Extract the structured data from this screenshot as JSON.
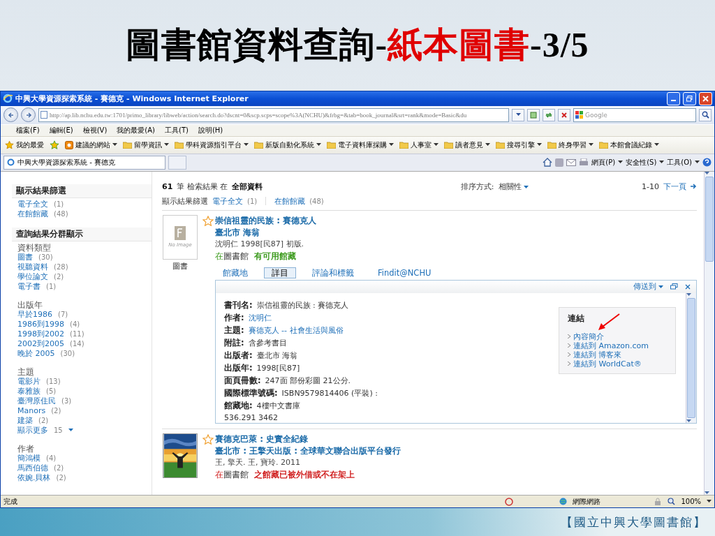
{
  "slide": {
    "title_parts": [
      {
        "text": "圖書館資料查詢-",
        "kind": "plain"
      },
      {
        "text": "紙本圖書",
        "kind": "accent"
      },
      {
        "text": "-3/5",
        "kind": "plain"
      }
    ],
    "footer": "【國立中興大學圖書館】"
  },
  "window": {
    "title": "中興大學資源探索系統 - 賽德克 - Windows Internet Explorer"
  },
  "address": {
    "url": "http://ap.lib.nchu.edu.tw:1701/primo_library/libweb/action/search.do?dscnt=0&scp.scps=scope%3A(NCHU)&frbg=&tab=book_journal&srt=rank&mode=Basic&du",
    "search_placeholder": "Google"
  },
  "menu": [
    "檔案(F)",
    "編輯(E)",
    "檢視(V)",
    "我的最愛(A)",
    "工具(T)",
    "說明(H)"
  ],
  "favorites": {
    "label": "我的最愛",
    "items": [
      {
        "label": "建議的網站",
        "kind": "site"
      },
      {
        "label": "留學資訊",
        "kind": "folder"
      },
      {
        "label": "學科資源指引平台",
        "kind": "folder"
      },
      {
        "label": "新版自動化系統",
        "kind": "folder"
      },
      {
        "label": "電子資料庫採購",
        "kind": "folder"
      },
      {
        "label": "人事室",
        "kind": "folder"
      },
      {
        "label": "讀者意見",
        "kind": "folder"
      },
      {
        "label": "搜尋引擎",
        "kind": "folder"
      },
      {
        "label": "終身學習",
        "kind": "folder"
      },
      {
        "label": "本館會議紀錄",
        "kind": "folder"
      }
    ]
  },
  "tab": {
    "label": "中興大學資源探索系統 - 賽德克"
  },
  "command_bar": [
    "網頁(P)",
    "安全性(S)",
    "工具(O)"
  ],
  "sidebar": {
    "sections": [
      {
        "title": "顯示結果篩選",
        "groups": [
          {
            "items": [
              {
                "label": "電子全文",
                "count": "(1)"
              },
              {
                "label": "在館館藏",
                "count": "(48)"
              }
            ]
          }
        ]
      },
      {
        "title": "查詢結果分群顯示",
        "groups": [
          {
            "heading": "資料類型",
            "items": [
              {
                "label": "圖書",
                "count": "(30)"
              },
              {
                "label": "視聽資料",
                "count": "(28)"
              },
              {
                "label": "學位論文",
                "count": "(2)"
              },
              {
                "label": "電子書",
                "count": "(1)"
              }
            ]
          },
          {
            "heading": "出版年",
            "items": [
              {
                "label": "早於1986",
                "count": "(7)"
              },
              {
                "label": "1986到1998",
                "count": "(4)"
              },
              {
                "label": "1998到2002",
                "count": "(11)"
              },
              {
                "label": "2002到2005",
                "count": "(14)"
              },
              {
                "label": "晚於 2005",
                "count": "(30)"
              }
            ]
          },
          {
            "heading": "主題",
            "items": [
              {
                "label": "電影片",
                "count": "(13)"
              },
              {
                "label": "泰雅族",
                "count": "(5)"
              },
              {
                "label": "臺灣原住民",
                "count": "(3)"
              },
              {
                "label": "Manors",
                "count": "(2)"
              },
              {
                "label": "建築",
                "count": "(2)"
              }
            ],
            "more": {
              "label": "顯示更多",
              "count": "15"
            }
          },
          {
            "heading": "作者",
            "items": [
              {
                "label": "簡鴻模",
                "count": "(4)"
              },
              {
                "label": "馬西伯德",
                "count": "(2)"
              },
              {
                "label": "依婉.貝林",
                "count": "(2)"
              }
            ]
          }
        ]
      }
    ]
  },
  "results_header": {
    "count": "61",
    "text": "筆 檢索結果 在",
    "scope": "全部資料",
    "sort_label": "排序方式:",
    "sort_value": "相關性",
    "range": "1-10",
    "next": "下一頁",
    "filter_label": "顯示結果篩選",
    "filters": [
      {
        "label": "電子全文",
        "count": "(1)"
      },
      {
        "label": "在館館藏",
        "count": "(48)"
      }
    ]
  },
  "results": [
    {
      "cover": {
        "kind": "placeholder",
        "text": "No Image"
      },
      "type": "圖書",
      "title": "崇信祖靈的民族 : 賽德克人",
      "publisher": "臺北市 海翁",
      "meta": "沈明仁 1998[民87] 初版.",
      "location": "在圖書館",
      "availability": "有可用館藏",
      "available": true,
      "tabs": [
        {
          "label": "館藏地",
          "selected": false
        },
        {
          "label": "詳目",
          "selected": true
        },
        {
          "label": "評論和標籤",
          "selected": false
        },
        {
          "label": "Findit@NCHU",
          "selected": false
        }
      ],
      "details": {
        "send_to": "傳送到",
        "fields": [
          {
            "label": "書刊名:",
            "value": "崇信祖靈的民族 : 賽德克人",
            "link": false
          },
          {
            "label": "作者:",
            "value": "沈明仁",
            "link": true
          },
          {
            "label": "主題:",
            "value": "賽德克人 -- 社會生活與風俗",
            "link": true
          },
          {
            "label": "附註:",
            "value": "含參考書目",
            "link": false
          },
          {
            "label": "出版者:",
            "value": "臺北市 海翁",
            "link": false
          },
          {
            "label": "出版年:",
            "value": "1998[民87]",
            "link": false
          },
          {
            "label": "面頁冊數:",
            "value": "247面 部份彩圖 21公分.",
            "link": false
          },
          {
            "label": "國際標準號碼:",
            "value": "ISBN9579814406 (平裝) :",
            "link": false
          },
          {
            "label": "館藏地:",
            "value": "4樓中文書庫",
            "link": false
          },
          {
            "value": "536.291 3462",
            "link": false
          }
        ],
        "links_title": "連結",
        "links": [
          "內容簡介",
          "連結到 Amazon.com",
          "連結到 博客來",
          "連結到 WorldCat®"
        ]
      }
    },
    {
      "title": "賽德克巴萊 : 史實全紀錄",
      "publisher": "臺北市 : 王擎天出版 : 全球華文聯合出版平台發行",
      "meta": "王, 擎天. 王, 寶玲. 2011",
      "location": "在圖書館",
      "availability": "之館藏已被外借或不在架上",
      "available": false
    }
  ],
  "status_bar": {
    "text": "完成",
    "zone": "網際網路",
    "zoom": "100%"
  }
}
